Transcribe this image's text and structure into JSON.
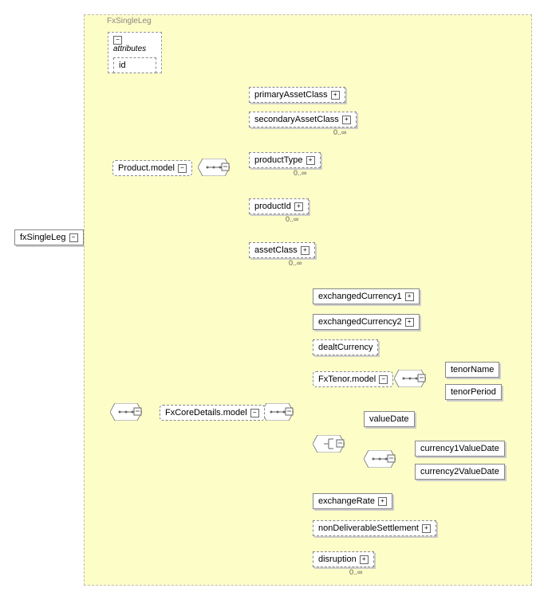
{
  "root": "fxSingleLeg",
  "typeName": "FxSingleLeg",
  "attributes": {
    "header": "attributes",
    "id": "id"
  },
  "product": {
    "model": "Product.model",
    "primaryAssetClass": "primaryAssetClass",
    "secondaryAssetClass": "secondaryAssetClass",
    "productType": "productType",
    "productId": "productId",
    "assetClass": "assetClass"
  },
  "fxcore": {
    "model": "FxCoreDetails.model",
    "exchangedCurrency1": "exchangedCurrency1",
    "exchangedCurrency2": "exchangedCurrency2",
    "dealtCurrency": "dealtCurrency",
    "fxTenor": "FxTenor.model",
    "tenorName": "tenorName",
    "tenorPeriod": "tenorPeriod",
    "valueDate": "valueDate",
    "currency1ValueDate": "currency1ValueDate",
    "currency2ValueDate": "currency2ValueDate",
    "exchangeRate": "exchangeRate",
    "nonDeliverableSettlement": "nonDeliverableSettlement",
    "disruption": "disruption"
  },
  "card": {
    "zeroInf": "0..∞"
  },
  "glyph": {
    "minus": "−",
    "plus": "+"
  }
}
